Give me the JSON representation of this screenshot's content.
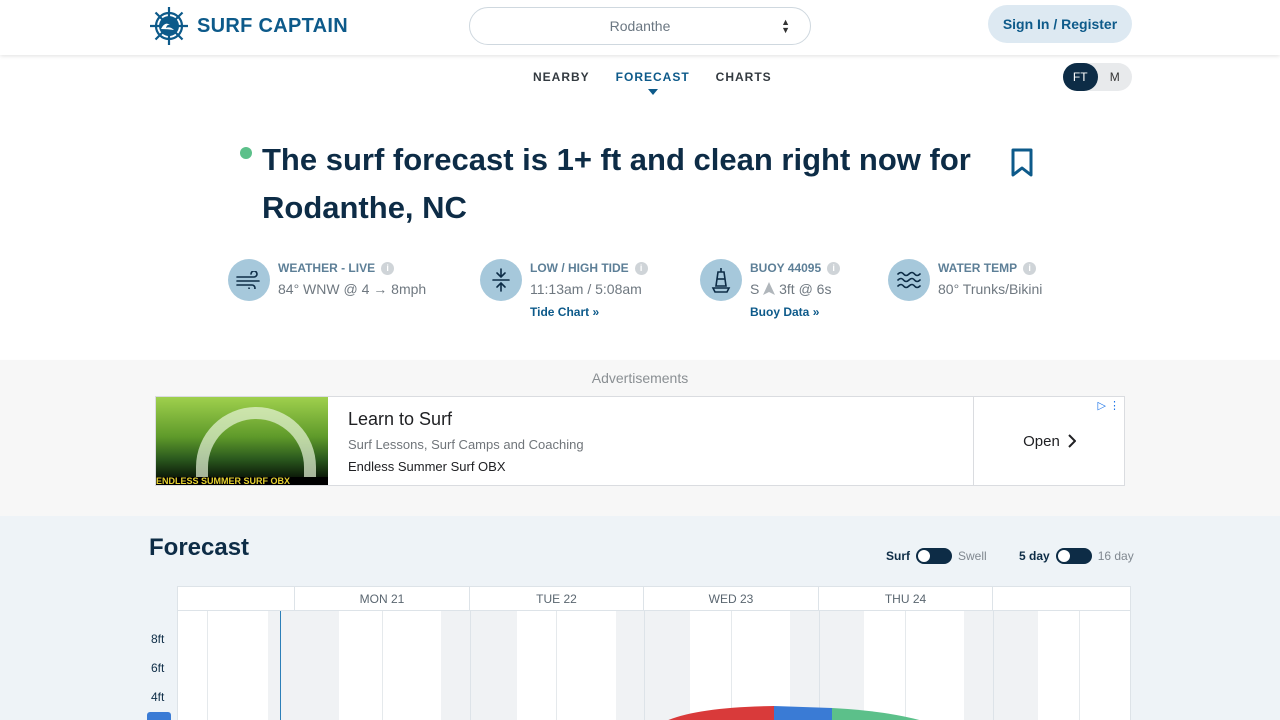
{
  "header": {
    "brand": "SURF CAPTAIN",
    "spot": "Rodanthe",
    "signin_label": "Sign In / Register"
  },
  "subnav": {
    "items": [
      "NEARBY",
      "FORECAST",
      "CHARTS"
    ],
    "active": "FORECAST"
  },
  "units": {
    "ft": "FT",
    "m": "M",
    "selected": "FT"
  },
  "headline": "The surf forecast is 1+ ft and clean right now for Rodanthe, NC",
  "conditions": [
    {
      "label": "WEATHER - LIVE",
      "value": "84° WNW @ 4 → 8mph",
      "icon": "wind-icon"
    },
    {
      "label": "LOW / HIGH TIDE",
      "value": "11:13am / 5:08am",
      "link": "Tide Chart",
      "icon": "tide-icon"
    },
    {
      "label": "BUOY 44095",
      "value_dir": "S",
      "value_rest": "3ft @ 6s",
      "link": "Buoy Data",
      "icon": "buoy-icon"
    },
    {
      "label": "WATER TEMP",
      "value": "80° Trunks/Bikini",
      "icon": "waves-icon"
    }
  ],
  "ads": {
    "label": "Advertisements",
    "title": "Learn to Surf",
    "subtitle": "Surf Lessons, Surf Camps and Coaching",
    "advertiser": "Endless Summer Surf OBX",
    "cta": "Open",
    "image_caption": "ENDLESS SUMMER SURF OBX"
  },
  "forecast": {
    "title": "Forecast",
    "toggle1": {
      "on": "Surf",
      "off": "Swell"
    },
    "toggle2": {
      "on": "5 day",
      "off": "16 day"
    },
    "days": [
      "MON 21",
      "TUE 22",
      "WED 23",
      "THU 24"
    ],
    "y_labels": [
      "8ft",
      "6ft",
      "4ft"
    ]
  },
  "colors": {
    "brand": "#0d5a8a",
    "navy": "#0d2c46",
    "live": "#5cc08a",
    "poor": "#d93a3a",
    "fair": "#3a7bd5",
    "good": "#5cc08a"
  }
}
